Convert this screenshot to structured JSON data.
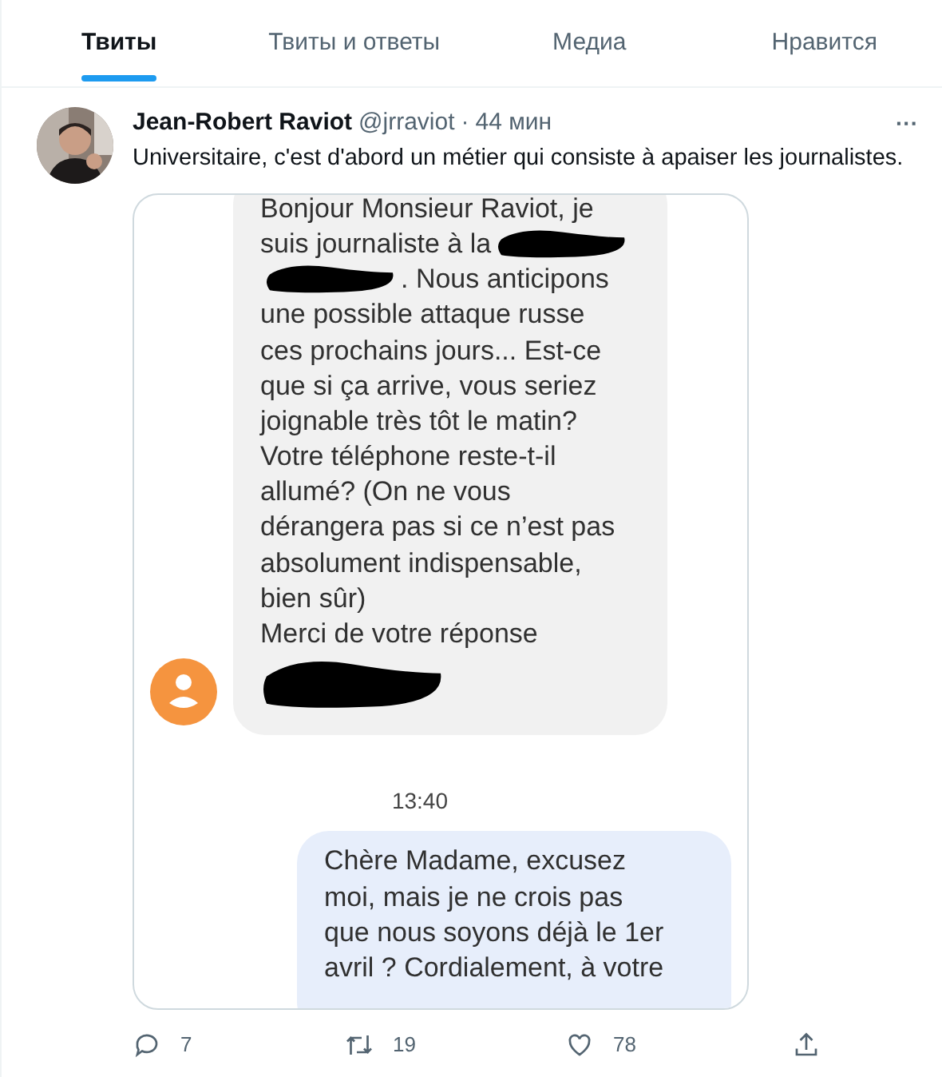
{
  "tabs": [
    {
      "label": "Твиты",
      "selected": true
    },
    {
      "label": "Твиты и ответы",
      "selected": false
    },
    {
      "label": "Медиа",
      "selected": false
    },
    {
      "label": "Нравится",
      "selected": false
    }
  ],
  "tweet": {
    "author": "Jean-Robert Raviot",
    "handle": "@jrraviot",
    "separator": "·",
    "time": "44 мин",
    "more": "···",
    "text": "Universitaire, c'est d'abord un métier qui consiste à apaiser les journalistes.",
    "image": {
      "messages": [
        {
          "kind": "incoming",
          "lines": [
            [
              {
                "kind": "text",
                "text": "Bonjour Monsieur Raviot, je"
              }
            ],
            [
              {
                "kind": "text",
                "text": "suis journaliste à la"
              },
              {
                "kind": "redaction"
              }
            ],
            [
              {
                "kind": "redaction"
              },
              {
                "kind": "text",
                "text": ". Nous anticipons"
              }
            ],
            [
              {
                "kind": "text",
                "text": "une possible attaque russe"
              }
            ],
            [
              {
                "kind": "text",
                "text": "ces prochains jours... Est-ce"
              }
            ],
            [
              {
                "kind": "text",
                "text": "que si ça arrive, vous seriez"
              }
            ],
            [
              {
                "kind": "text",
                "text": "joignable très tôt le matin?"
              }
            ],
            [
              {
                "kind": "text",
                "text": "Votre téléphone reste-t-il"
              }
            ],
            [
              {
                "kind": "text",
                "text": "allumé? (On ne vous"
              }
            ],
            [
              {
                "kind": "text",
                "text": "dérangera pas si ce n’est pas"
              }
            ],
            [
              {
                "kind": "text",
                "text": "absolument indispensable,"
              }
            ],
            [
              {
                "kind": "text",
                "text": "bien sûr)"
              }
            ],
            [
              {
                "kind": "text",
                "text": "Merci de votre réponse"
              }
            ],
            [
              {
                "kind": "signature"
              }
            ]
          ]
        },
        {
          "kind": "timestamp",
          "text": "13:40"
        },
        {
          "kind": "outgoing",
          "lines": [
            [
              {
                "kind": "text",
                "text": "Chère Madame, excusez"
              }
            ],
            [
              {
                "kind": "text",
                "text": "moi, mais je ne crois pas"
              }
            ],
            [
              {
                "kind": "text",
                "text": "que nous soyons déjà le 1er"
              }
            ],
            [
              {
                "kind": "text",
                "text": "avril ? Cordialement, à votre"
              }
            ]
          ]
        }
      ]
    },
    "actions": [
      {
        "kind": "reply",
        "count": "7"
      },
      {
        "kind": "retweet",
        "count": "19"
      },
      {
        "kind": "like",
        "count": "78"
      },
      {
        "kind": "share"
      }
    ]
  }
}
